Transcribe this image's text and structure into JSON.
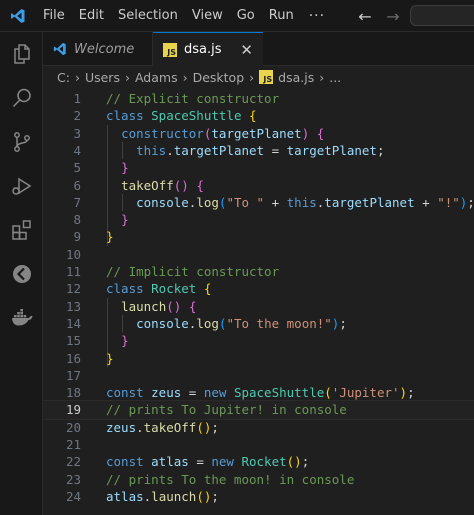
{
  "menu": {
    "items": [
      "File",
      "Edit",
      "Selection",
      "View",
      "Go",
      "Run"
    ],
    "more": "···"
  },
  "nav": {
    "back_icon": "←",
    "forward_icon": "→"
  },
  "tabs": [
    {
      "label": "Welcome",
      "icon": "vscode-icon"
    },
    {
      "label": "dsa.js",
      "icon": "js-file-icon",
      "badge": "JS",
      "close": "✕"
    }
  ],
  "breadcrumb": {
    "parts": [
      "C:",
      "Users",
      "Adams",
      "Desktop"
    ],
    "file": "dsa.js",
    "separator": "›",
    "tail": "..."
  },
  "editor": {
    "current_line": 19,
    "lines": [
      {
        "n": "1",
        "tokens": [
          [
            "    ",
            "plain"
          ],
          [
            "// Explicit constructor",
            "comment"
          ]
        ]
      },
      {
        "n": "2",
        "tokens": [
          [
            "    ",
            "plain"
          ],
          [
            "class ",
            "kw"
          ],
          [
            "SpaceShuttle",
            "class"
          ],
          [
            " ",
            "plain"
          ],
          [
            "{",
            "brace1"
          ]
        ]
      },
      {
        "n": "3",
        "tokens": [
          [
            "      ",
            "plain"
          ],
          [
            "constructor",
            "kw"
          ],
          [
            "(",
            "brace2"
          ],
          [
            "targetPlanet",
            "param"
          ],
          [
            ")",
            "brace2"
          ],
          [
            " ",
            "plain"
          ],
          [
            "{",
            "brace2"
          ]
        ]
      },
      {
        "n": "4",
        "tokens": [
          [
            "        ",
            "plain"
          ],
          [
            "this",
            "kw"
          ],
          [
            ".",
            "plain"
          ],
          [
            "targetPlanet",
            "prop"
          ],
          [
            " = ",
            "plain"
          ],
          [
            "targetPlanet",
            "param"
          ],
          [
            ";",
            "plain"
          ]
        ]
      },
      {
        "n": "5",
        "tokens": [
          [
            "      ",
            "plain"
          ],
          [
            "}",
            "brace2"
          ]
        ]
      },
      {
        "n": "6",
        "tokens": [
          [
            "      ",
            "plain"
          ],
          [
            "takeOff",
            "fn"
          ],
          [
            "()",
            "brace2"
          ],
          [
            " ",
            "plain"
          ],
          [
            "{",
            "brace2"
          ]
        ]
      },
      {
        "n": "7",
        "tokens": [
          [
            "        ",
            "plain"
          ],
          [
            "console",
            "var"
          ],
          [
            ".",
            "plain"
          ],
          [
            "log",
            "fn"
          ],
          [
            "(",
            "brace3"
          ],
          [
            "\"To \"",
            "str"
          ],
          [
            " + ",
            "plain"
          ],
          [
            "this",
            "kw"
          ],
          [
            ".",
            "plain"
          ],
          [
            "targetPlanet",
            "prop"
          ],
          [
            " + ",
            "plain"
          ],
          [
            "\"!\"",
            "str"
          ],
          [
            ")",
            "brace3"
          ],
          [
            ";",
            "plain"
          ]
        ]
      },
      {
        "n": "8",
        "tokens": [
          [
            "      ",
            "plain"
          ],
          [
            "}",
            "brace2"
          ]
        ]
      },
      {
        "n": "9",
        "tokens": [
          [
            "    ",
            "plain"
          ],
          [
            "}",
            "brace1"
          ]
        ]
      },
      {
        "n": "10",
        "tokens": []
      },
      {
        "n": "11",
        "tokens": [
          [
            "    ",
            "plain"
          ],
          [
            "// Implicit constructor",
            "comment"
          ]
        ]
      },
      {
        "n": "12",
        "tokens": [
          [
            "    ",
            "plain"
          ],
          [
            "class ",
            "kw"
          ],
          [
            "Rocket",
            "class"
          ],
          [
            " ",
            "plain"
          ],
          [
            "{",
            "brace1"
          ]
        ]
      },
      {
        "n": "13",
        "tokens": [
          [
            "      ",
            "plain"
          ],
          [
            "launch",
            "fn"
          ],
          [
            "()",
            "brace2"
          ],
          [
            " ",
            "plain"
          ],
          [
            "{",
            "brace2"
          ]
        ]
      },
      {
        "n": "14",
        "tokens": [
          [
            "        ",
            "plain"
          ],
          [
            "console",
            "var"
          ],
          [
            ".",
            "plain"
          ],
          [
            "log",
            "fn"
          ],
          [
            "(",
            "brace3"
          ],
          [
            "\"To the moon!\"",
            "str"
          ],
          [
            ")",
            "brace3"
          ],
          [
            ";",
            "plain"
          ]
        ]
      },
      {
        "n": "15",
        "tokens": [
          [
            "      ",
            "plain"
          ],
          [
            "}",
            "brace2"
          ]
        ]
      },
      {
        "n": "16",
        "tokens": [
          [
            "    ",
            "plain"
          ],
          [
            "}",
            "brace1"
          ]
        ]
      },
      {
        "n": "17",
        "tokens": []
      },
      {
        "n": "18",
        "tokens": [
          [
            "    ",
            "plain"
          ],
          [
            "const ",
            "kw"
          ],
          [
            "zeus",
            "var"
          ],
          [
            " = ",
            "plain"
          ],
          [
            "new ",
            "kw"
          ],
          [
            "SpaceShuttle",
            "class"
          ],
          [
            "(",
            "brace1"
          ],
          [
            "'Jupiter'",
            "str"
          ],
          [
            ")",
            "brace1"
          ],
          [
            ";",
            "plain"
          ]
        ]
      },
      {
        "n": "19",
        "tokens": [
          [
            "    ",
            "plain"
          ],
          [
            "// prints To Jupiter! in console",
            "comment"
          ]
        ]
      },
      {
        "n": "20",
        "tokens": [
          [
            "    ",
            "plain"
          ],
          [
            "zeus",
            "var"
          ],
          [
            ".",
            "plain"
          ],
          [
            "takeOff",
            "fn"
          ],
          [
            "()",
            "brace1"
          ],
          [
            ";",
            "plain"
          ]
        ]
      },
      {
        "n": "21",
        "tokens": []
      },
      {
        "n": "22",
        "tokens": [
          [
            "    ",
            "plain"
          ],
          [
            "const ",
            "kw"
          ],
          [
            "atlas",
            "var"
          ],
          [
            " = ",
            "plain"
          ],
          [
            "new ",
            "kw"
          ],
          [
            "Rocket",
            "class"
          ],
          [
            "()",
            "brace1"
          ],
          [
            ";",
            "plain"
          ]
        ]
      },
      {
        "n": "23",
        "tokens": [
          [
            "    ",
            "plain"
          ],
          [
            "// prints To the moon! in console",
            "comment"
          ]
        ]
      },
      {
        "n": "24",
        "tokens": [
          [
            "    ",
            "plain"
          ],
          [
            "atlas",
            "var"
          ],
          [
            ".",
            "plain"
          ],
          [
            "launch",
            "fn"
          ],
          [
            "()",
            "brace1"
          ],
          [
            ";",
            "plain"
          ]
        ]
      }
    ]
  },
  "colors": {
    "accent": "#0078d4",
    "logo": "#3b9ee8",
    "js_badge": "#e8d44d"
  }
}
